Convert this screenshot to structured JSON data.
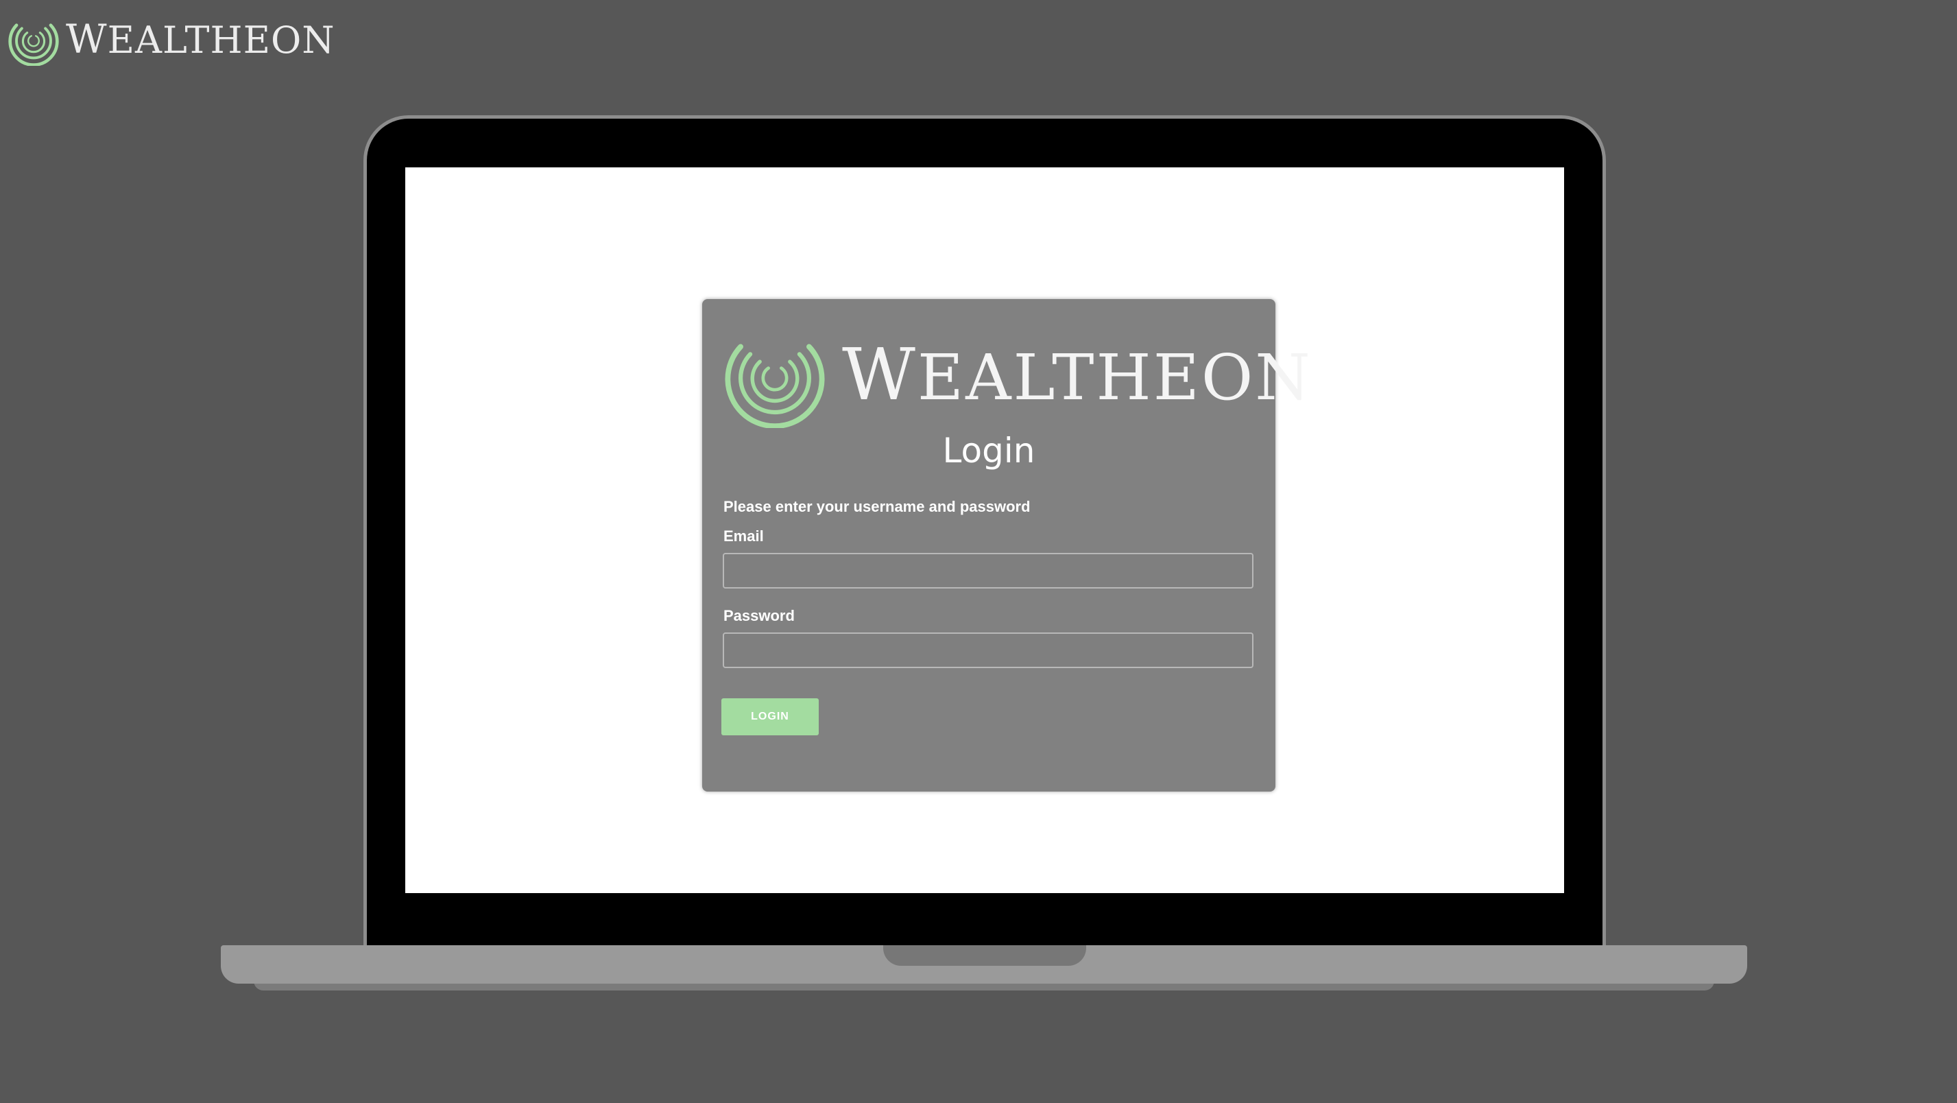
{
  "brand": {
    "name_initial": "W",
    "name_rest": "EALTHEON",
    "accent_color": "#a3dca0",
    "logo_icon": "wealtheon-swirl-icon"
  },
  "login": {
    "title": "Login",
    "instructions": "Please enter your username and password",
    "email_label": "Email",
    "email_value": "",
    "password_label": "Password",
    "password_value": "",
    "button_label": "LOGIN"
  }
}
